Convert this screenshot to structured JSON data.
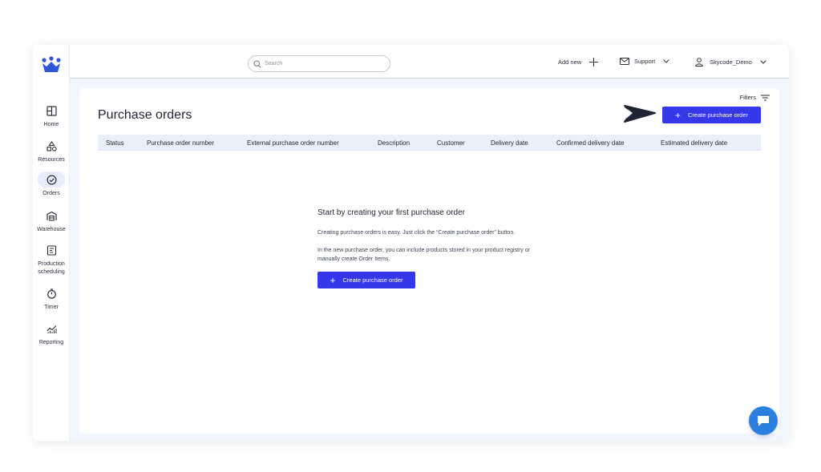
{
  "sidebar": {
    "items": [
      {
        "label": "Home",
        "icon": "home-icon"
      },
      {
        "label": "Resources",
        "icon": "resources-icon"
      },
      {
        "label": "Orders",
        "icon": "orders-icon",
        "active": true
      },
      {
        "label": "Warehouse",
        "icon": "warehouse-icon"
      },
      {
        "label": "Production scheduling",
        "icon": "production-scheduling-icon"
      },
      {
        "label": "Timer",
        "icon": "timer-icon"
      },
      {
        "label": "Reporting",
        "icon": "reporting-icon"
      }
    ]
  },
  "topbar": {
    "search_placeholder": "Search",
    "add_new": "Add new",
    "support": "Support",
    "user": "Skycode_Demo"
  },
  "main": {
    "filters": "Filters",
    "title": "Purchase orders",
    "create_button": "Create purchase order",
    "columns": [
      "Status",
      "Purchase order number",
      "External purchase order number",
      "Description",
      "Customer",
      "Delivery date",
      "Confirmed delivery date",
      "Estimated delivery date"
    ]
  },
  "empty_state": {
    "title": "Start by creating your first purchase order",
    "paragraph1": "Creating purchase orders is easy. Just click the “Create purchase order” button.",
    "paragraph2": "In the new purchase order, you can include products stored in your product registry or manually create Order Items.",
    "button": "Create purchase order"
  },
  "colors": {
    "accent": "#3637e8",
    "background": "#f1f5fd",
    "table_header": "#eaf0fb",
    "chat": "#2a7fe0"
  }
}
